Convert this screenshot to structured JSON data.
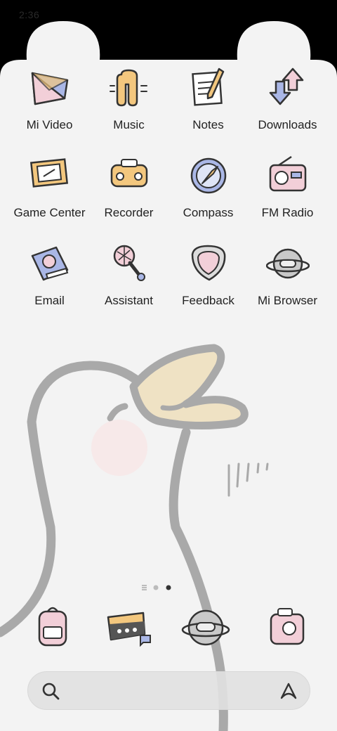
{
  "status_bar": {
    "time": "2:36"
  },
  "apps": [
    {
      "label": "Mi Video",
      "icon": "mi-video-icon"
    },
    {
      "label": "Music",
      "icon": "music-icon"
    },
    {
      "label": "Notes",
      "icon": "notes-icon"
    },
    {
      "label": "Downloads",
      "icon": "downloads-icon"
    },
    {
      "label": "Game Center",
      "icon": "game-center-icon"
    },
    {
      "label": "Recorder",
      "icon": "recorder-icon"
    },
    {
      "label": "Compass",
      "icon": "compass-icon"
    },
    {
      "label": "FM Radio",
      "icon": "fm-radio-icon"
    },
    {
      "label": "Email",
      "icon": "email-icon"
    },
    {
      "label": "Assistant",
      "icon": "assistant-icon"
    },
    {
      "label": "Feedback",
      "icon": "feedback-icon"
    },
    {
      "label": "Mi Browser",
      "icon": "mi-browser-icon"
    }
  ],
  "dock": [
    "backpack-app-icon",
    "messages-app-icon",
    "planet-app-icon",
    "camera-app-icon"
  ],
  "page_indicator": {
    "pages": 2,
    "current_page": 2
  },
  "search_bar": {
    "search_icon": "search-icon",
    "assistant_icon": "assistant-logo-icon"
  },
  "colors": {
    "wallpaper": "#f3f3f3",
    "outline": "#a8a8a8",
    "beak": "#efe2c4",
    "cheek": "#f7e6e6",
    "icon_blue": "#aab7e6",
    "icon_yellow": "#f3c77e",
    "icon_pink": "#f2cfd8"
  }
}
